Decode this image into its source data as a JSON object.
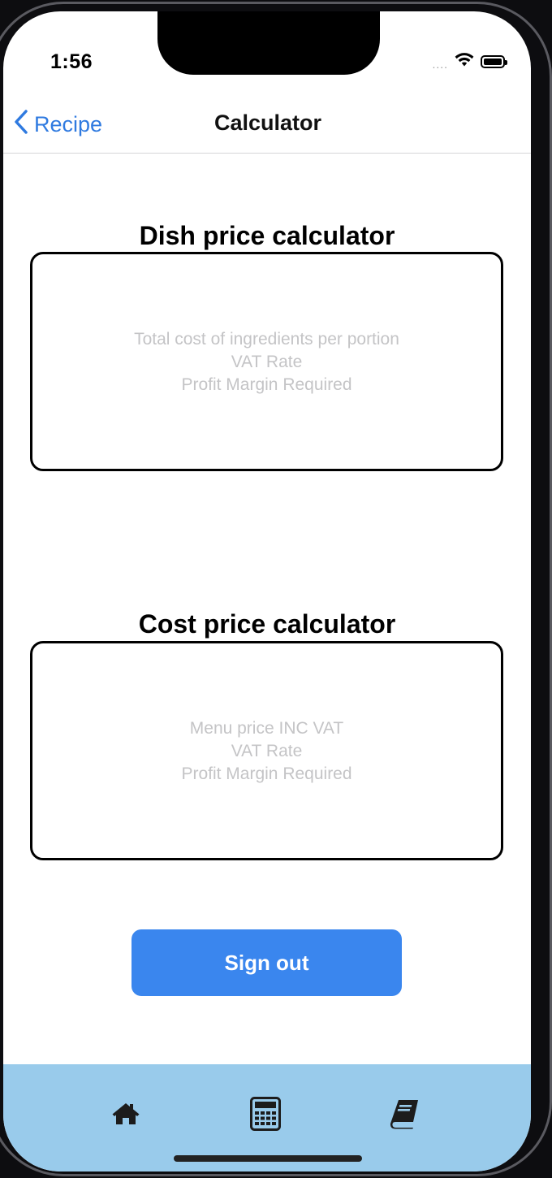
{
  "status_bar": {
    "time": "1:56",
    "signal": "....",
    "icons": [
      "wifi-icon",
      "battery-icon"
    ]
  },
  "nav": {
    "back_label": "Recipe",
    "title": "Calculator"
  },
  "dish_calculator": {
    "title": "Dish price calculator",
    "fields": [
      {
        "placeholder": "Total cost of ingredients per portion"
      },
      {
        "placeholder": "VAT Rate"
      },
      {
        "placeholder": "Profit Margin Required"
      }
    ]
  },
  "cost_calculator": {
    "title": "Cost price calculator",
    "fields": [
      {
        "placeholder": "Menu price INC VAT"
      },
      {
        "placeholder": "VAT Rate"
      },
      {
        "placeholder": "Profit Margin Required"
      }
    ]
  },
  "sign_out_label": "Sign out",
  "tab_bar": {
    "items": [
      {
        "icon": "home-icon"
      },
      {
        "icon": "calculator-icon"
      },
      {
        "icon": "book-icon"
      }
    ]
  },
  "colors": {
    "accent": "#2f7ae0",
    "button": "#3a86ee",
    "tab_bar": "#99cbeb",
    "placeholder": "#c4c4c6"
  }
}
